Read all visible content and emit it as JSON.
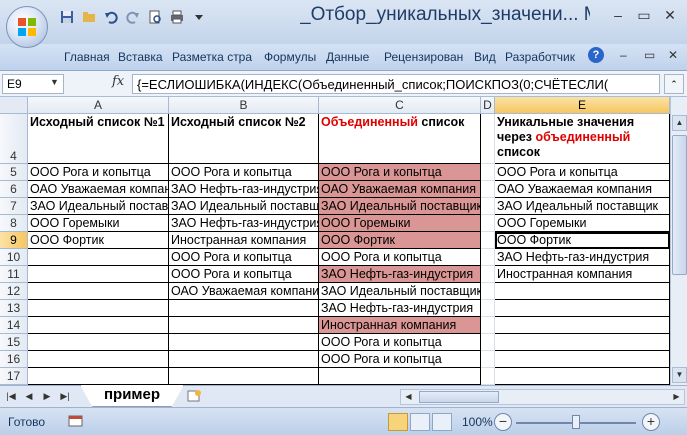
{
  "window": {
    "title": "_Отбор_уникальных_значени... M",
    "controls": [
      "–",
      "▭",
      "✕"
    ]
  },
  "ribbon": {
    "tabs": [
      "Главная",
      "Вставка",
      "Разметка стра",
      "Формулы",
      "Данные",
      "Рецензирован",
      "Вид",
      "Разработчик"
    ],
    "help_label": "?"
  },
  "formula_bar": {
    "name_box": "E9",
    "fx_label": "fx",
    "formula": "{=ЕСЛИОШИБКА(ИНДЕКС(Объединенный_список;ПОИСКПОЗ(0;СЧЁТЕСЛИ("
  },
  "columns": [
    {
      "letter": "A"
    },
    {
      "letter": "B"
    },
    {
      "letter": "C"
    },
    {
      "letter": "D"
    },
    {
      "letter": "E"
    }
  ],
  "rows": [
    "4",
    "5",
    "6",
    "7",
    "8",
    "9",
    "10",
    "11",
    "12",
    "13",
    "14",
    "15",
    "16",
    "17"
  ],
  "headers": {
    "a": "Исходный список №1",
    "b": "Исходный список №2",
    "c_part1": "Объединенный",
    "c_part2": " список",
    "e_part1": "Уникальные значения через ",
    "e_part2": "объединенный",
    "e_part3": " список"
  },
  "list_a": [
    "ООО Рога и копытца",
    "ОАО Уважаемая компания",
    "ЗАО Идеальный поставщик",
    "ООО Горемыки",
    "ООО Фортик"
  ],
  "list_b": [
    "ООО Рога и копытца",
    "ЗАО Нефть-газ-индустрия",
    "ЗАО Идеальный поставщик",
    "ЗАО Нефть-газ-индустрия",
    "Иностранная компания",
    "ООО Рога и копытца",
    "ООО Рога и копытца",
    "ОАО Уважаемая компания"
  ],
  "list_c": [
    "ООО Рога и копытца",
    "ОАО Уважаемая компания",
    "ЗАО Идеальный поставщик",
    "ООО Горемыки",
    "ООО Фортик",
    "ООО Рога и копытца",
    "ЗАО Нефть-газ-индустрия",
    "ЗАО Идеальный поставщик",
    "ЗАО Нефть-газ-индустрия",
    "Иностранная компания",
    "ООО Рога и копытца",
    "ООО Рога и копытца"
  ],
  "list_e": [
    "ООО Рога и копытца",
    "ОАО Уважаемая компания",
    "ЗАО Идеальный поставщик",
    "ООО Горемыки",
    "ООО Фортик",
    "ЗАО Нефть-газ-индустрия",
    "Иностранная компания"
  ],
  "sheet": {
    "tab_name": "пример"
  },
  "status": {
    "ready": "Готово",
    "zoom": "100%"
  },
  "colors": {
    "highlight": "#d99694",
    "header_red": "#e00000",
    "selection": "#f5c660"
  }
}
